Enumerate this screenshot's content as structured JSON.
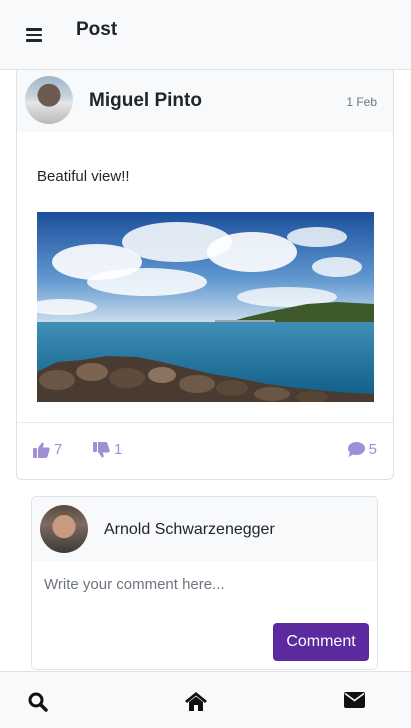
{
  "header": {
    "title": "Post",
    "menu_icon": "hamburger-icon"
  },
  "post": {
    "author": "Miguel Pinto",
    "date": "1 Feb",
    "text": "Beatiful view!!",
    "likes": "7",
    "dislikes": "1",
    "comments": "5"
  },
  "comment_box": {
    "user": "Arnold Schwarzenegger",
    "placeholder": "Write your comment here...",
    "button_label": "Comment"
  },
  "bottom_nav": {
    "items": [
      "search-icon",
      "home-icon",
      "envelope-icon"
    ]
  },
  "colors": {
    "accent": "#5b2a9e",
    "reaction": "#9f8fd6",
    "bar_bg": "#f8f9fa"
  }
}
